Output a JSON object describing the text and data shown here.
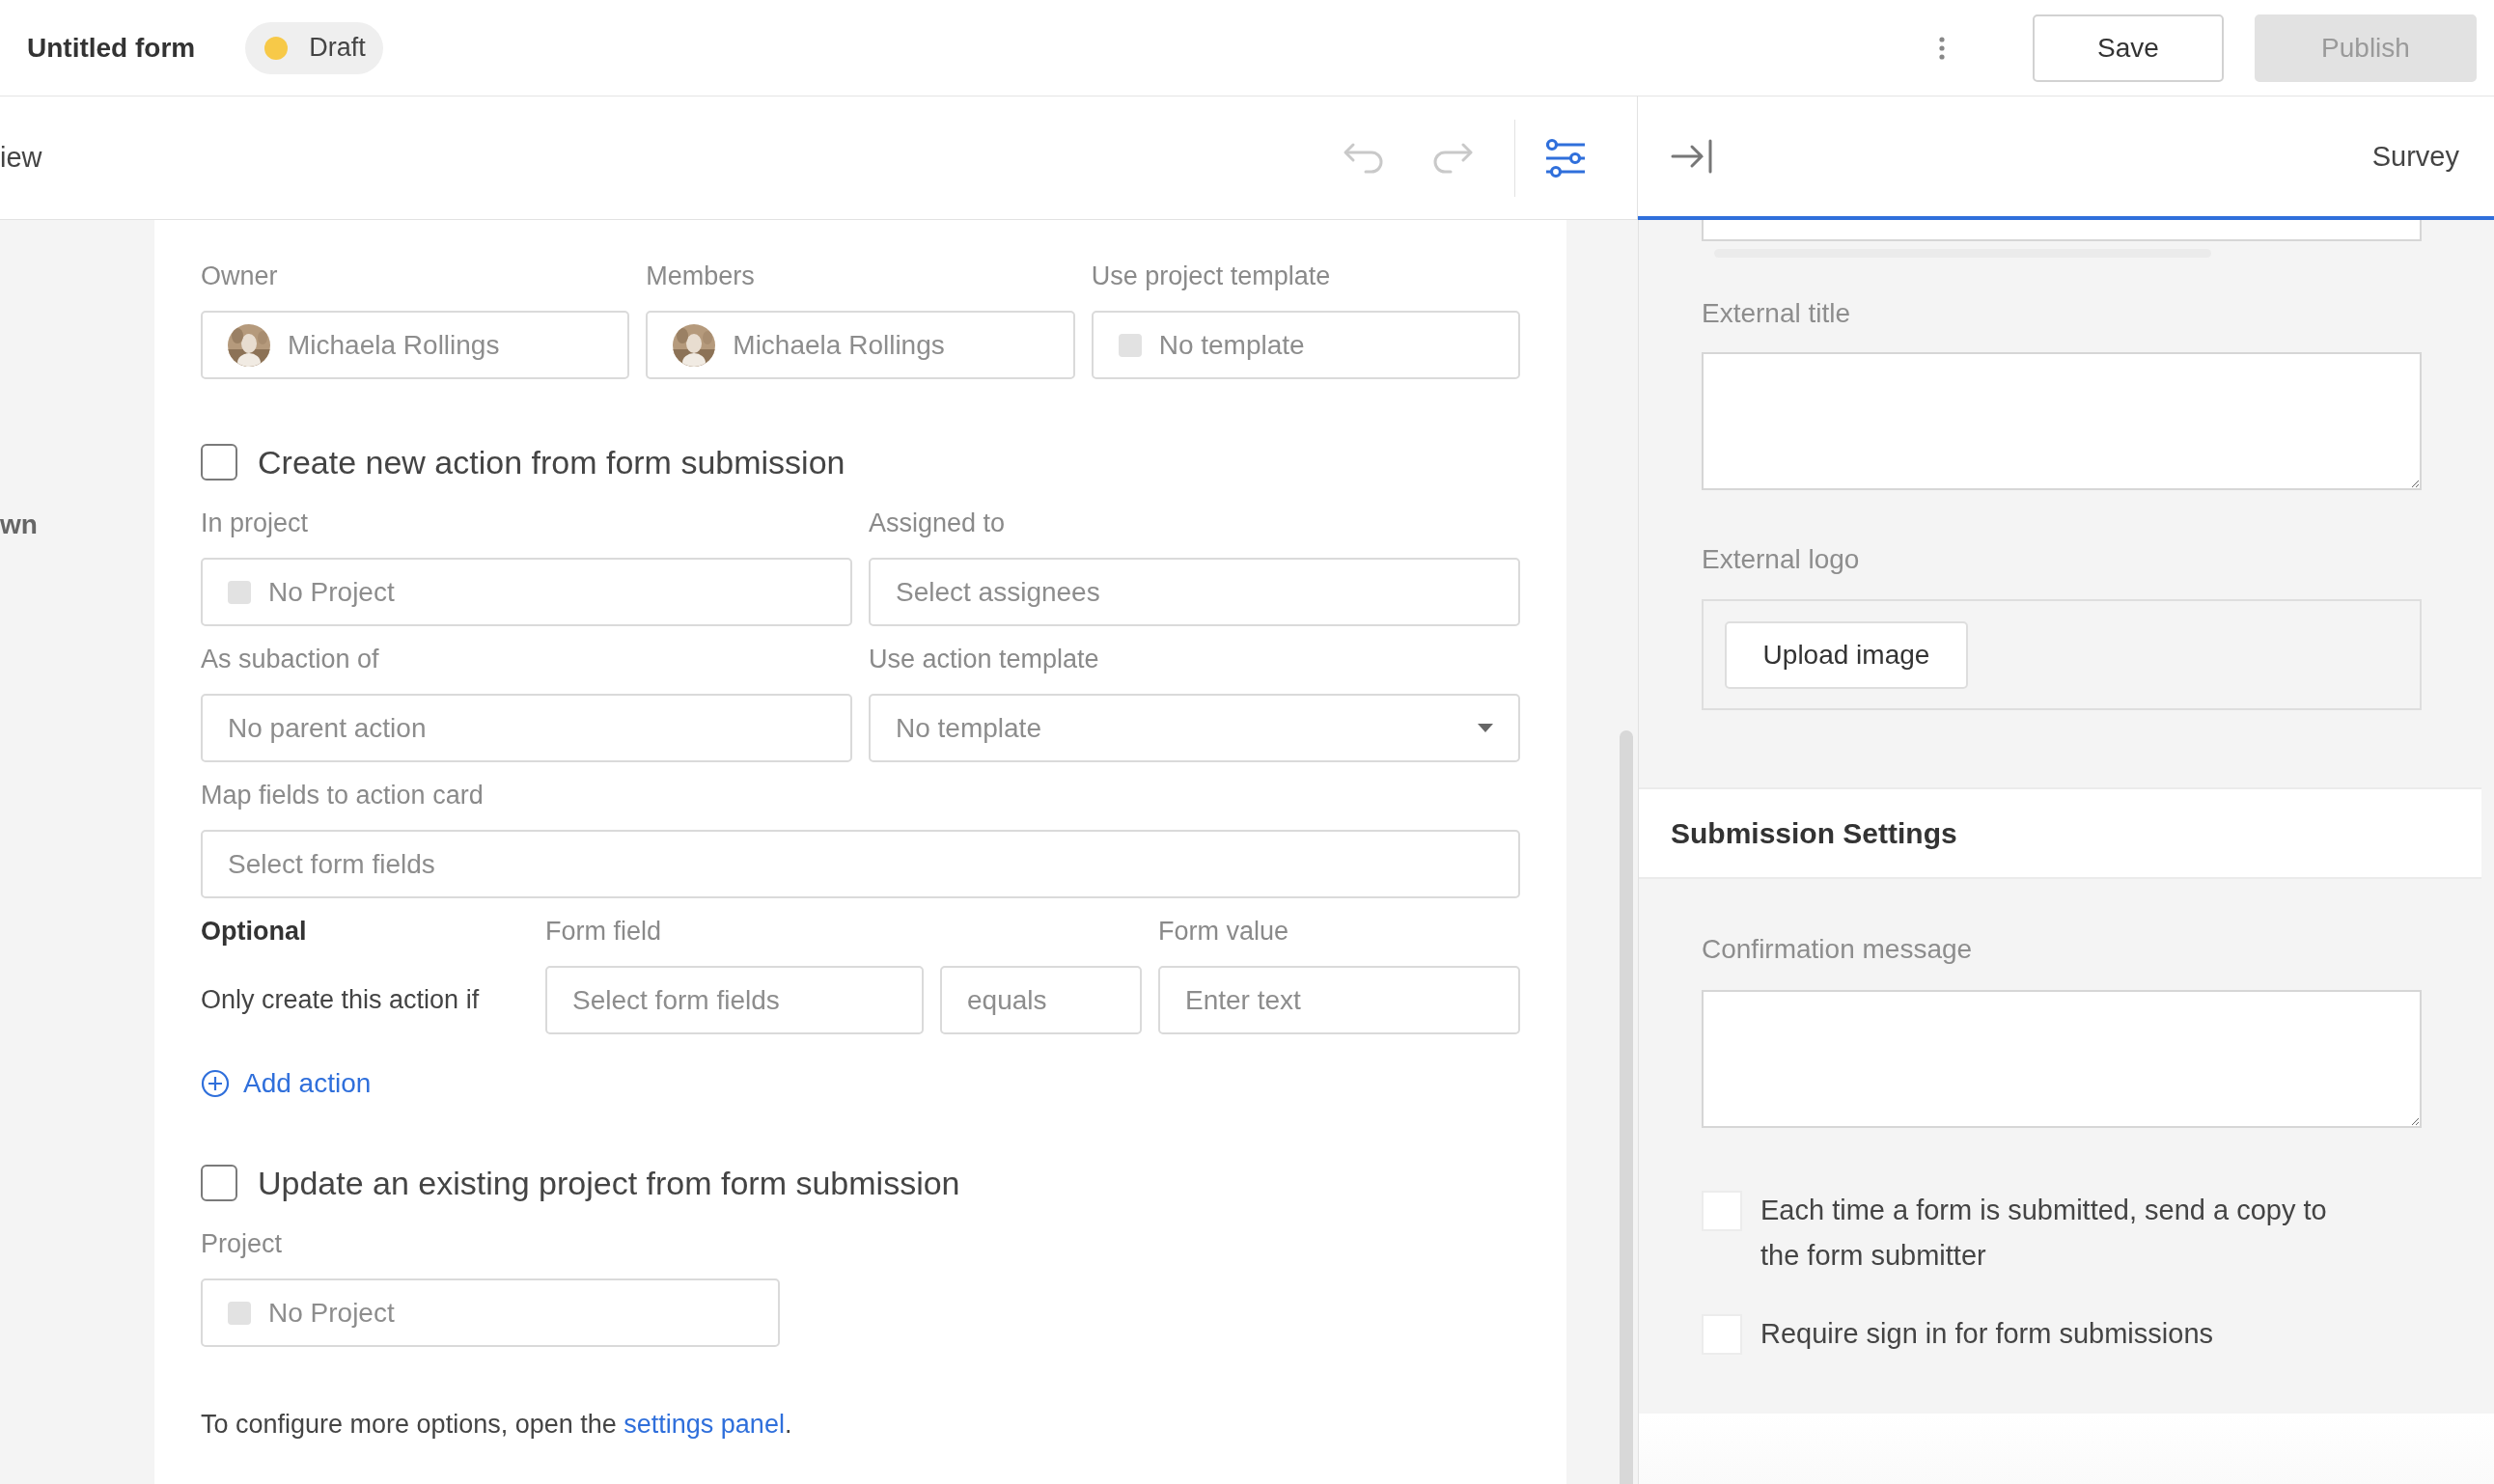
{
  "header": {
    "title": "Untitled form",
    "status": {
      "label": "Draft",
      "color": "#f7c948"
    },
    "buttons": [
      {
        "label": "Save",
        "kind": "outline"
      },
      {
        "label": "Publish",
        "kind": "disabled"
      }
    ]
  },
  "toolbar": {
    "view_tab": "iew",
    "undo": {
      "disabled": true
    },
    "redo": {
      "disabled": true
    },
    "settings": {
      "selected": true
    },
    "panel_title": "Survey"
  },
  "sidebar": {
    "item": "wn"
  },
  "form": {
    "project": {
      "fields": [
        {
          "label": "Owner",
          "kind": "person",
          "value": "Michaela Rollings"
        },
        {
          "label": "Members",
          "kind": "person",
          "value": "Michaela Rollings"
        },
        {
          "label": "Use project template",
          "kind": "swatch",
          "value": "No template"
        }
      ]
    },
    "action": {
      "label": "Create new action from form submission",
      "checked": false,
      "fields": [
        {
          "label": "In project",
          "kind": "swatch",
          "value": "No Project"
        },
        {
          "label": "Assigned to",
          "kind": "text",
          "placeholder": "Select assignees"
        },
        {
          "label": "As subaction of",
          "kind": "text",
          "placeholder": "No parent action"
        },
        {
          "label": "Use action template",
          "kind": "dropdown",
          "value": "No template"
        }
      ],
      "mapping": {
        "label": "Map fields to action card",
        "placeholder": "Select form fields"
      },
      "condition": {
        "heading": "Optional",
        "field_label": "Form field",
        "value_label": "Form value",
        "prefix": "Only create this action if",
        "field": {
          "placeholder": "Select form fields"
        },
        "operator": {
          "value": "equals"
        },
        "value": {
          "placeholder": "Enter text"
        }
      },
      "add_link": "Add action"
    },
    "update": {
      "label": "Update an existing project from form submission",
      "checked": false,
      "fields": [
        {
          "label": "Project",
          "kind": "swatch",
          "value": "No Project"
        }
      ]
    },
    "footer": {
      "text": "To configure more options, open the ",
      "link": "settings panel",
      "end": "."
    }
  },
  "settings": {
    "fields": [
      {
        "kind": "textarea",
        "label": "External title"
      },
      {
        "kind": "upload",
        "label": "External logo",
        "button": "Upload image"
      }
    ],
    "section": "Submission Settings",
    "message": {
      "label": "Confirmation message"
    },
    "options": [
      {
        "label": "Each time a form is submitted, send a copy to the form submitter",
        "checked": false
      },
      {
        "label": "Require sign in for form submissions",
        "checked": false
      }
    ]
  }
}
